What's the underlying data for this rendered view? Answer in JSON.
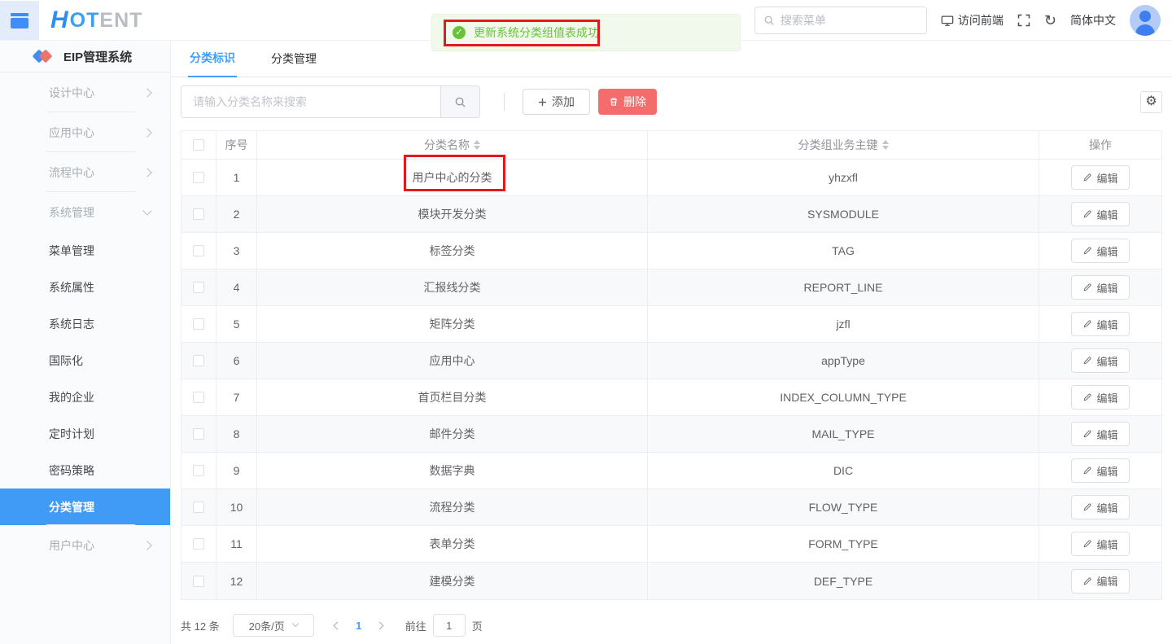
{
  "icons": {
    "gear": "⚙",
    "refresh": "↻",
    "check": "✓"
  },
  "header": {
    "logo": {
      "h": "H",
      "blue": "OT",
      "gray": "ENT"
    },
    "search_placeholder": "搜索菜单",
    "visit_frontend": "访问前端",
    "language": "简体中文"
  },
  "toast": {
    "message": "更新系统分类组值表成功"
  },
  "sidebar": {
    "title": "EIP管理系统",
    "items": [
      {
        "label": "设计中心",
        "chevron": "right",
        "divider": true
      },
      {
        "label": "应用中心",
        "chevron": "right",
        "divider": true
      },
      {
        "label": "流程中心",
        "chevron": "right",
        "divider": true
      },
      {
        "label": "系统管理",
        "chevron": "down"
      },
      {
        "label": "菜单管理",
        "child": true
      },
      {
        "label": "系统属性",
        "child": true
      },
      {
        "label": "系统日志",
        "child": true
      },
      {
        "label": "国际化",
        "child": true
      },
      {
        "label": "我的企业",
        "child": true
      },
      {
        "label": "定时计划",
        "child": true
      },
      {
        "label": "密码策略",
        "child": true
      },
      {
        "label": "分类管理",
        "child": true,
        "active": true,
        "divider": true
      },
      {
        "label": "用户中心",
        "chevron": "right"
      }
    ]
  },
  "tabs": [
    {
      "label": "分类标识"
    },
    {
      "label": "分类管理"
    }
  ],
  "toolbar": {
    "search_placeholder": "请输入分类名称来搜索",
    "add_label": "添加",
    "delete_label": "删除"
  },
  "table": {
    "headers": {
      "index": "序号",
      "name": "分类名称",
      "key": "分类组业务主键",
      "actions": "操作"
    },
    "edit_label": "编辑",
    "rows": [
      {
        "no": 1,
        "name": "用户中心的分类",
        "key": "yhzxfl"
      },
      {
        "no": 2,
        "name": "模块开发分类",
        "key": "SYSMODULE"
      },
      {
        "no": 3,
        "name": "标签分类",
        "key": "TAG"
      },
      {
        "no": 4,
        "name": "汇报线分类",
        "key": "REPORT_LINE"
      },
      {
        "no": 5,
        "name": "矩阵分类",
        "key": "jzfl"
      },
      {
        "no": 6,
        "name": "应用中心",
        "key": "appType"
      },
      {
        "no": 7,
        "name": "首页栏目分类",
        "key": "INDEX_COLUMN_TYPE"
      },
      {
        "no": 8,
        "name": "邮件分类",
        "key": "MAIL_TYPE"
      },
      {
        "no": 9,
        "name": "数据字典",
        "key": "DIC"
      },
      {
        "no": 10,
        "name": "流程分类",
        "key": "FLOW_TYPE"
      },
      {
        "no": 11,
        "name": "表单分类",
        "key": "FORM_TYPE"
      },
      {
        "no": 12,
        "name": "建模分类",
        "key": "DEF_TYPE"
      }
    ]
  },
  "pagination": {
    "total_text": "共 12 条",
    "page_size": "20条/页",
    "current_page": "1",
    "goto_label": "前往",
    "goto_value": "1",
    "page_unit": "页"
  }
}
